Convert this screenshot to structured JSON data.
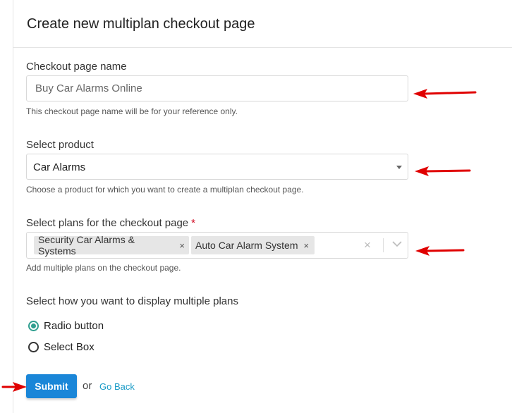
{
  "header": {
    "title": "Create new multiplan checkout page"
  },
  "checkout_name": {
    "label": "Checkout page name",
    "placeholder": "Buy Car Alarms Online",
    "value": "",
    "help": "This checkout page name will be for your reference only."
  },
  "product": {
    "label": "Select product",
    "selected": "Car Alarms",
    "help": "Choose a product for which you want to create a multiplan checkout page."
  },
  "plans": {
    "label": "Select plans for the checkout page",
    "required_mark": "*",
    "tags": [
      {
        "label": "Security Car Alarms & Systems",
        "remove": "×"
      },
      {
        "label": "Auto Car Alarm System",
        "remove": "×"
      }
    ],
    "clear": "×",
    "help": "Add multiple plans on the checkout page."
  },
  "display": {
    "label": "Select how you want to display multiple plans",
    "options": [
      {
        "label": "Radio button",
        "checked": true
      },
      {
        "label": "Select Box",
        "checked": false
      }
    ]
  },
  "actions": {
    "submit": "Submit",
    "or": "or",
    "go_back": "Go Back"
  },
  "colors": {
    "primary": "#1a86d8",
    "radio_accent": "#2f9e8f",
    "link": "#1a9bc7",
    "annotation_arrow": "#e00000"
  },
  "icons": {
    "dropdown": "caret-down-icon",
    "chevron": "chevron-down-icon",
    "clear": "close-icon",
    "arrow": "red-arrow-icon"
  }
}
